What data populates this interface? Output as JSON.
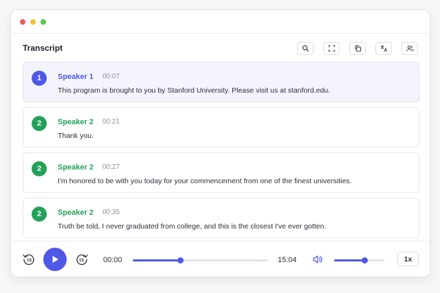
{
  "window": {
    "controls": {
      "close_color": "#ee5d5a",
      "minimize_color": "#f5bd3e",
      "maximize_color": "#5dc64f"
    }
  },
  "header": {
    "title": "Transcript",
    "tools": [
      "search-icon",
      "fullscreen-icon",
      "copy-icon",
      "translate-icon",
      "speakers-icon"
    ]
  },
  "segments": [
    {
      "badge": "1",
      "speaker": "Speaker 1",
      "time": "00:07",
      "text": "This program is brought to you by Stanford University. Please visit us at stanford.edu.",
      "color": "#5058e6",
      "active": true
    },
    {
      "badge": "2",
      "speaker": "Speaker 2",
      "time": "00:21",
      "text": "Thank you.",
      "color": "#23a15a",
      "active": false
    },
    {
      "badge": "2",
      "speaker": "Speaker 2",
      "time": "00:27",
      "text": "I'm honored to be with you today for your commencement from one of the finest universities.",
      "color": "#23a15a",
      "active": false
    },
    {
      "badge": "2",
      "speaker": "Speaker 2",
      "time": "00:35",
      "text": "Truth be told, I never graduated from college, and this is the closest I've ever gotten.",
      "color": "#23a15a",
      "active": false
    }
  ],
  "player": {
    "skip_back": "15",
    "skip_forward": "15",
    "current_time": "00:00",
    "duration": "15:04",
    "progress": 0.35,
    "volume": 0.6,
    "rate": "1x",
    "accent": "#5058e6"
  }
}
